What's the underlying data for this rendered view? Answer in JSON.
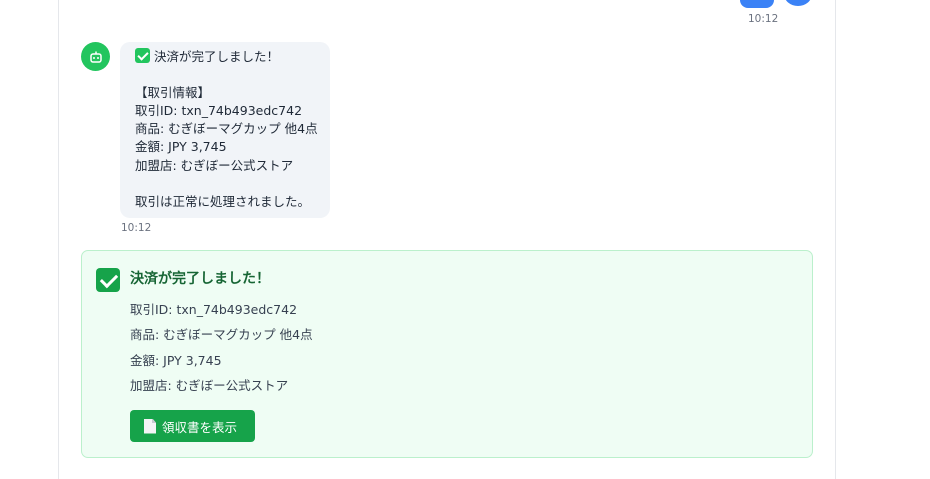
{
  "top_message": {
    "time": "10:12"
  },
  "bot_message": {
    "lines": [
      "決済が完了しました！",
      "",
      "【取引情報】",
      "取引ID: txn_74b493edc742",
      "商品: むぎぼーマグカップ 他4点",
      "金額: JPY 3,745",
      "加盟店: むぎぼー公式ストア",
      "",
      "取引は正常に処理されました。"
    ],
    "time": "10:12"
  },
  "payment_card": {
    "title": "決済が完了しました！",
    "transaction_id": "取引ID: txn_74b493edc742",
    "product": "商品: むぎぼーマグカップ 他4点",
    "amount": "金額: JPY 3,745",
    "merchant": "加盟店: むぎぼー公式ストア",
    "receipt_button_label": "領収書を表示"
  },
  "colors": {
    "user_bubble": "#3b82f6",
    "bot_avatar": "#22c55e",
    "success_bg": "#effdf4",
    "success_border": "#bbf0cc",
    "success_text": "#166534",
    "button": "#16a34a"
  },
  "icons": {
    "bot_avatar": "robot-icon",
    "success": "check-icon",
    "receipt": "document-icon"
  }
}
